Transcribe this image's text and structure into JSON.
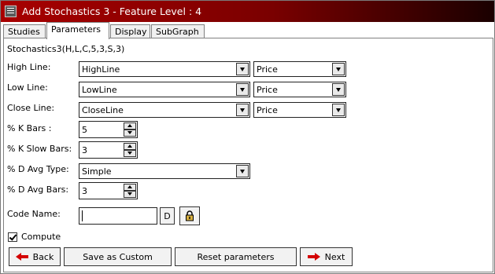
{
  "window": {
    "title": "Add Stochastics 3 - Feature Level : 4"
  },
  "tabs": [
    {
      "label": "Studies"
    },
    {
      "label": "Parameters"
    },
    {
      "label": "Display"
    },
    {
      "label": "SubGraph"
    }
  ],
  "formula": "Stochastics3(H,L,C,5,3,S,3)",
  "fields": {
    "high_line": {
      "label": "High Line:",
      "value": "HighLine",
      "type_value": "Price"
    },
    "low_line": {
      "label": "Low Line:",
      "value": "LowLine",
      "type_value": "Price"
    },
    "close_line": {
      "label": "Close Line:",
      "value": "CloseLine",
      "type_value": "Price"
    },
    "k_bars": {
      "label": "% K Bars :",
      "value": "5"
    },
    "k_slow_bars": {
      "label": "% K Slow Bars:",
      "value": "3"
    },
    "d_avg_type": {
      "label": "% D Avg Type:",
      "value": "Simple"
    },
    "d_avg_bars": {
      "label": "% D Avg Bars:",
      "value": "3"
    },
    "code_name": {
      "label": "Code Name:",
      "value": "",
      "d_button": "D"
    }
  },
  "compute": {
    "label": "Compute",
    "checked": true
  },
  "buttons": {
    "back": "Back",
    "save_custom": "Save as Custom",
    "reset": "Reset parameters",
    "next": "Next"
  },
  "icons": {
    "app": "app-icon",
    "lock": "lock-icon",
    "back": "arrow-left-icon",
    "next": "arrow-right-icon"
  },
  "colors": {
    "titlebar_start": "#a80000",
    "titlebar_end": "#1a0000",
    "arrow": "#d40000"
  }
}
